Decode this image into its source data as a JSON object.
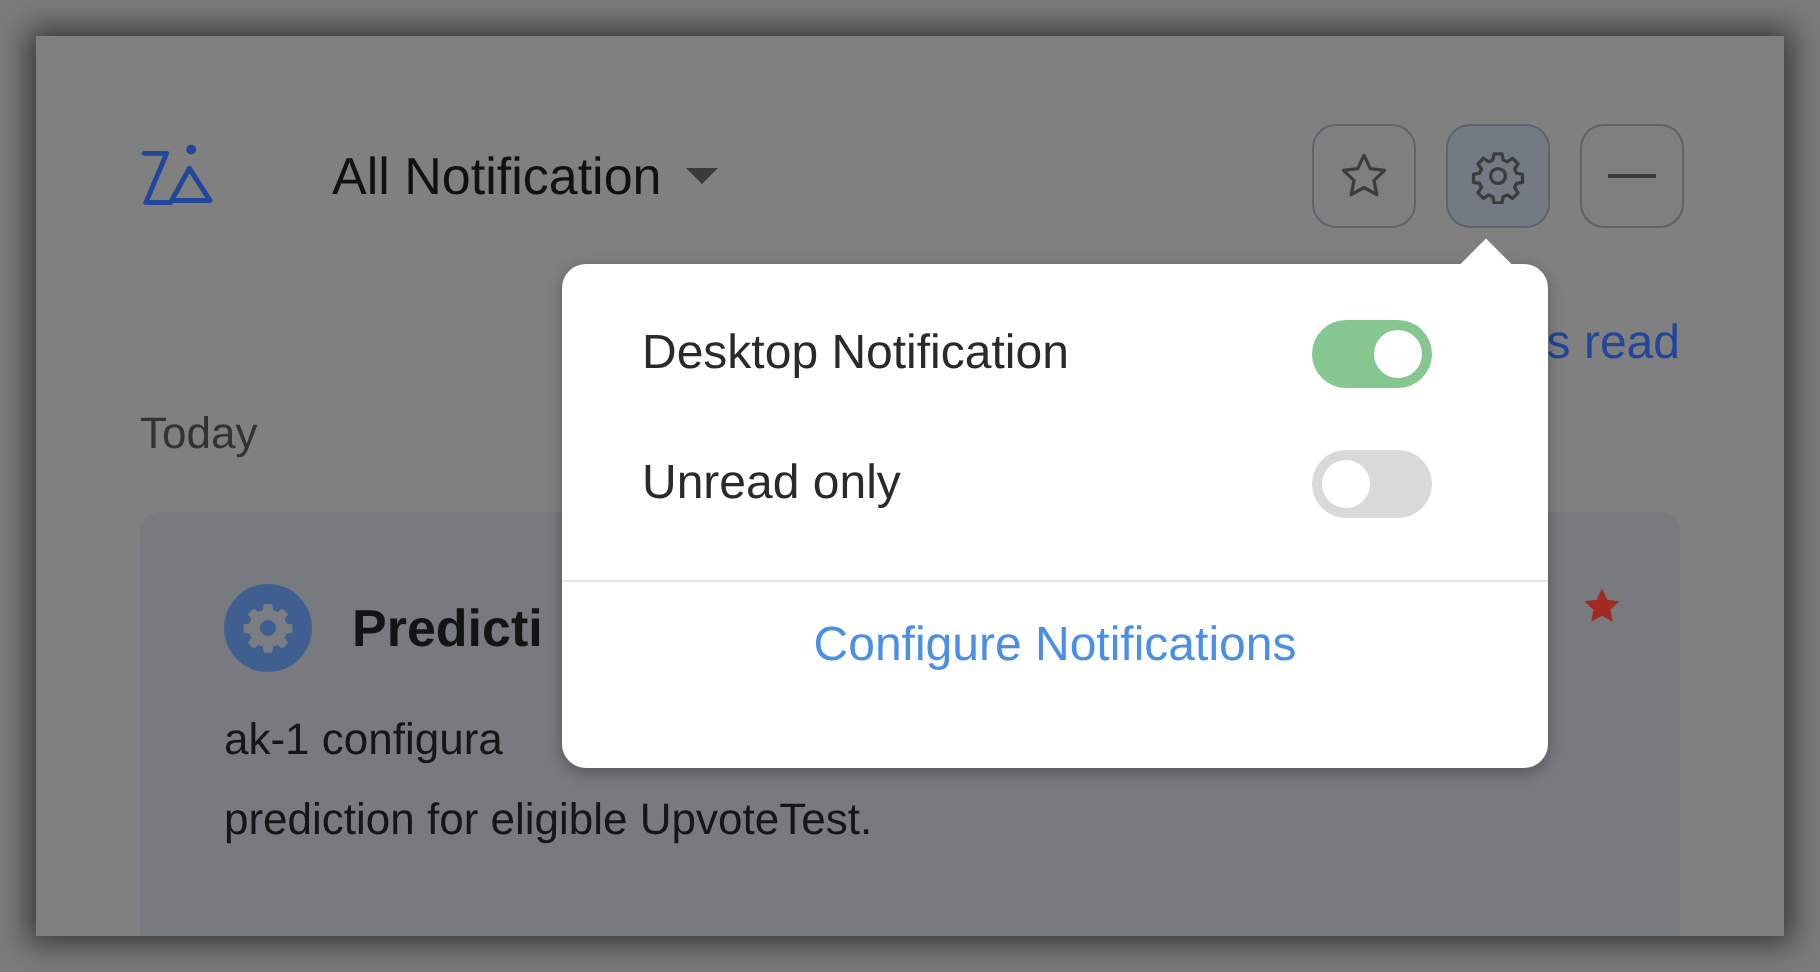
{
  "header": {
    "title": "All Notification",
    "buttons": [
      {
        "kind": "star"
      },
      {
        "kind": "settings",
        "selected": true
      },
      {
        "kind": "minimize"
      }
    ]
  },
  "mark_read_link": "s read",
  "section": "Today",
  "notification": {
    "title": "Predicti",
    "lines": [
      "ak-1 configura",
      "prediction for eligible UpvoteTest."
    ],
    "starred": true
  },
  "settings_popover": {
    "options": [
      {
        "label": "Desktop Notification",
        "on": true
      },
      {
        "label": "Unread only",
        "on": false
      }
    ],
    "link": "Configure Notifications"
  }
}
